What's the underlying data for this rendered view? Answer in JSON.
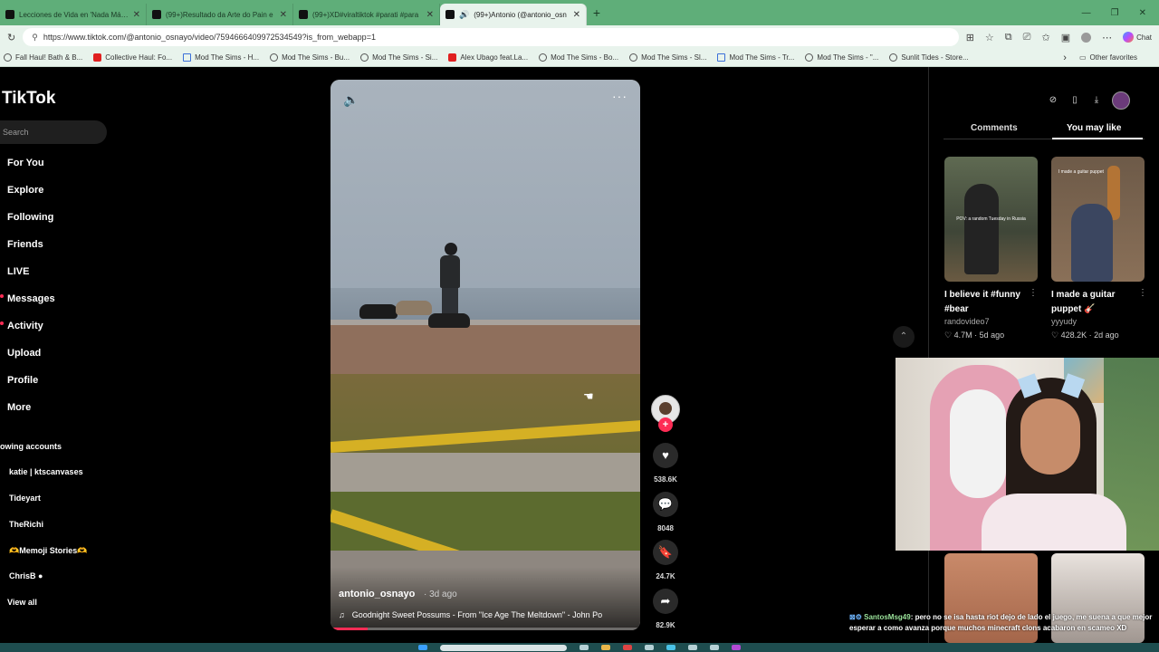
{
  "browser": {
    "tabs": [
      {
        "title": "Lecciones de Vida en 'Nada Más C",
        "active": false
      },
      {
        "title": "(99+)Resultado da Arte do Pain e",
        "active": false
      },
      {
        "title": "(99+)XD#viraltiktok #parati #para",
        "active": false
      },
      {
        "title": "(99+)Antonio (@antonio_osn",
        "active": true
      }
    ],
    "new_tab": "+",
    "url": "https://www.tiktok.com/@antonio_osnayo/video/7594666409972534549?is_from_webapp=1",
    "chat_label": "Chat",
    "bookmarks": [
      {
        "label": "Fall Haul! Bath & B...",
        "icon": "globe"
      },
      {
        "label": "Collective Haul: Fo...",
        "icon": "youtube"
      },
      {
        "label": "Mod The Sims - H...",
        "icon": "square"
      },
      {
        "label": "Mod The Sims - Bu...",
        "icon": "globe"
      },
      {
        "label": "Mod The Sims - Si...",
        "icon": "globe"
      },
      {
        "label": "Alex Ubago feat.La...",
        "icon": "youtube"
      },
      {
        "label": "Mod The Sims - Bo...",
        "icon": "globe"
      },
      {
        "label": "Mod The Sims - Sl...",
        "icon": "globe"
      },
      {
        "label": "Mod The Sims - Tr...",
        "icon": "square"
      },
      {
        "label": "Mod The Sims - \"...",
        "icon": "globe"
      },
      {
        "label": "Sunlit Tides - Store...",
        "icon": "globe"
      }
    ],
    "other_favorites": "Other favorites"
  },
  "tiktok": {
    "logo": "TikTok",
    "search_placeholder": "Search",
    "nav": [
      "For You",
      "Explore",
      "Following",
      "Friends",
      "LIVE",
      "Messages",
      "Activity",
      "Upload",
      "Profile",
      "More"
    ],
    "following_header": "owing accounts",
    "accounts": [
      "katie | ktscanvases",
      "Tideyart",
      "TheRichi",
      "🫶Memoji Stories🫶",
      "ChrisB ●"
    ],
    "view_all": "View all"
  },
  "video": {
    "username": "antonio_osnayo",
    "ago": "· 3d ago",
    "song_icon": "♫",
    "song": "Goodnight Sweet Possums - From \"Ice Age The Meltdown\" - John Po",
    "progress": 0.12,
    "likes": "538.6K",
    "comments": "8048",
    "saves": "24.7K",
    "shares": "82.9K"
  },
  "panel": {
    "tab_comments": "Comments",
    "tab_you_may_like": "You may like",
    "cards": [
      {
        "title": "I believe it #funny #bear",
        "author": "randovideo7",
        "stats": "♡ 4.7M · 5d ago",
        "thumb_text": "POV: a random Tuesday in Russia"
      },
      {
        "title": "I made a guitar puppet 🎸",
        "author": "yyyudy",
        "stats": "♡ 428.2K · 2d ago",
        "thumb_text": "I made a guitar puppet"
      }
    ]
  },
  "stream_chat": {
    "user": "SantosMsg49",
    "message": ": pero no se isa hasta riot dejo de lado el juego, me suena a que mejor esperar a como avanza porque muchos minecraft clons acabaron en scameo XD"
  },
  "colors": {
    "tiktok_red": "#fe2c55",
    "browser_green": "#5fae79"
  }
}
